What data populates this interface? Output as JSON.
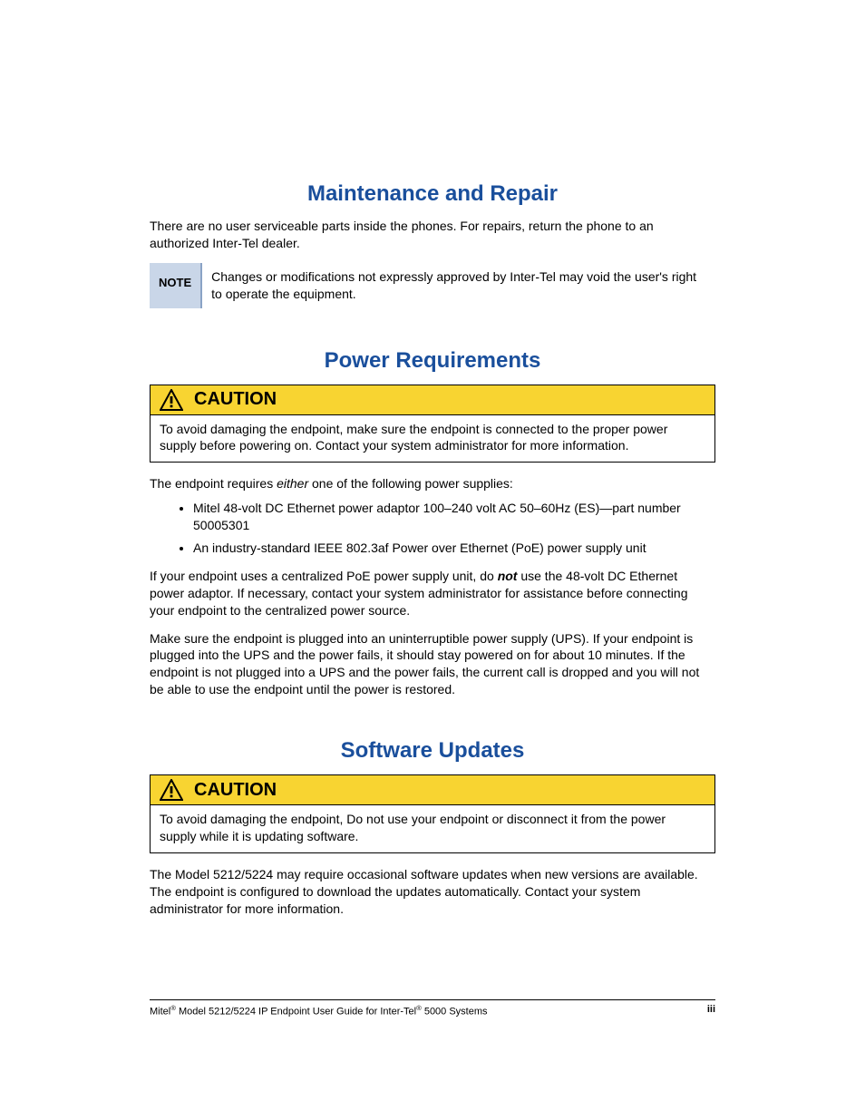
{
  "sections": {
    "maintenance": {
      "title": "Maintenance and Repair",
      "intro": "There are no user serviceable parts inside the phones. For repairs, return the phone to an authorized Inter-Tel dealer.",
      "note_label": "NOTE",
      "note_text": "Changes or modifications not expressly approved by Inter-Tel may void the user's right to operate the equipment."
    },
    "power": {
      "title": "Power Requirements",
      "caution_label": "CAUTION",
      "caution_text": "To avoid damaging the endpoint, make sure the endpoint is connected to the proper power supply before powering on. Contact your system administrator for more information.",
      "intro_pre": "The endpoint requires ",
      "intro_em": "either",
      "intro_post": " one of the following power supplies:",
      "bullets": [
        "Mitel 48-volt DC Ethernet power adaptor 100–240 volt AC 50–60Hz (ES)—part number 50005301",
        "An industry-standard IEEE 802.3af Power over Ethernet (PoE) power supply unit"
      ],
      "para1_pre": "If your endpoint uses a centralized PoE power supply unit, do ",
      "para1_em": "not",
      "para1_post": " use the 48-volt DC Ethernet power adaptor. If necessary, contact your system administrator for assistance before connecting your endpoint to the centralized power source.",
      "para2": "Make sure the endpoint is plugged into an uninterruptible power supply (UPS). If your endpoint is plugged into the UPS and the power fails, it should stay powered on for about 10 minutes. If the endpoint is not plugged into a UPS and the power fails, the current call is dropped and you will not be able to use the endpoint until the power is restored."
    },
    "software": {
      "title": "Software Updates",
      "caution_label": "CAUTION",
      "caution_text": "To avoid damaging the endpoint, Do not use your endpoint or disconnect it from the power supply while it is updating software.",
      "para": "The Model 5212/5224 may require occasional software updates when new versions are available. The endpoint is configured to download the updates automatically. Contact your system administrator for more information."
    }
  },
  "footer": {
    "left_1": "Mitel",
    "left_sup1": "®",
    "left_2": " Model 5212/5224 IP Endpoint User Guide for Inter-Tel",
    "left_sup2": "®",
    "left_3": " 5000 Systems",
    "right": "iii"
  }
}
